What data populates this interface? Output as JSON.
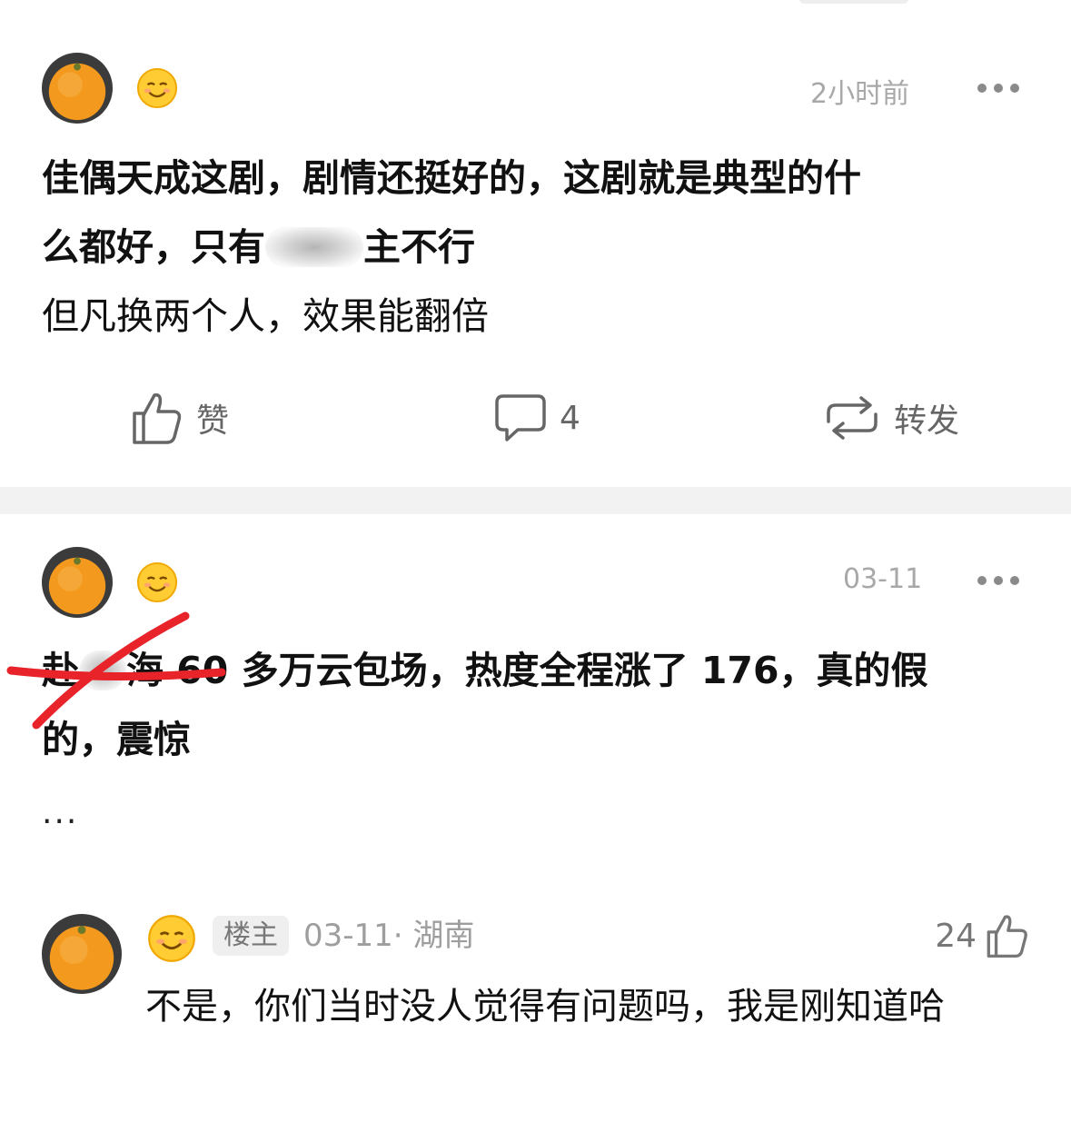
{
  "post1": {
    "time": "2小时前",
    "content_line1": "佳偶天成这剧，剧情还挺好的，这剧就是典型的什",
    "content_line2_pre": "么都好，只有",
    "content_line2_post": "主不行",
    "content_line3": "但凡换两个人，效果能翻倍",
    "actions": {
      "like_label": "赞",
      "comment_count": "4",
      "repost_label": "转发"
    }
  },
  "post2": {
    "time": "03-11",
    "content_line1_a": "赴",
    "content_line1_b": "海",
    "content_line1_c": "60",
    "content_line1_d": " 多万云包场，热度全程涨了 176，真的假",
    "content_line2": "的，震惊",
    "ellipsis": "...",
    "reply": {
      "badge": "楼主",
      "meta": "03-11· 湖南",
      "like_count": "24",
      "text": "不是，你们当时没人觉得有问题吗，我是刚知道哈"
    }
  },
  "colors": {
    "background": "#ffffff",
    "divider": "#f2f2f2",
    "muted_text": "#a8a8a8",
    "strike_red": "#e8232a",
    "avatar_orange": "#f39a1e"
  },
  "icons": {
    "avatar": "orange-fruit-avatar",
    "emoji": "smiling-face-emoji",
    "like": "thumbs-up-icon",
    "comment": "comment-bubble-icon",
    "repost": "repost-arrows-icon",
    "more": "more-dots-icon"
  }
}
